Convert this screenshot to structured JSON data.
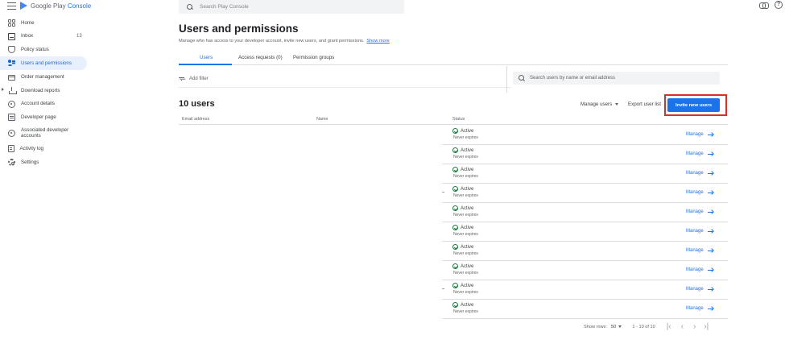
{
  "app": {
    "brand_prefix": "Google Play ",
    "brand_suffix": "Console",
    "top_search_placeholder": "Search Play Console"
  },
  "sidebar": {
    "items": [
      {
        "label": "Home",
        "icon": "home-grid-icon"
      },
      {
        "label": "Inbox",
        "icon": "inbox-icon",
        "badge": "13"
      },
      {
        "label": "Policy status",
        "icon": "shield-icon"
      },
      {
        "label": "Users and permissions",
        "icon": "users-icon",
        "selected": true
      },
      {
        "label": "Order management",
        "icon": "credit-card-icon"
      },
      {
        "label": "Download reports",
        "icon": "download-icon"
      },
      {
        "label": "Account details",
        "icon": "account-icon"
      },
      {
        "label": "Developer page",
        "icon": "developer-page-icon"
      },
      {
        "label": "Associated developer accounts",
        "icon": "associated-accounts-icon"
      },
      {
        "label": "Activity log",
        "icon": "activity-log-icon"
      },
      {
        "label": "Settings",
        "icon": "gear-icon"
      }
    ]
  },
  "page": {
    "title": "Users and permissions",
    "subtitle": "Manage who has access to your developer account, invite new users, and grant permissions.",
    "show_more": "Show more",
    "tabs": [
      {
        "label": "Users",
        "active": true
      },
      {
        "label": "Access requests (0)"
      },
      {
        "label": "Permission groups"
      }
    ],
    "add_filter": "Add filter",
    "user_search_placeholder": "Search users by name or email address",
    "count_title": "10 users",
    "manage_users": "Manage users",
    "export": "Export user list",
    "invite": "Invite new users",
    "highlight_color": "#d93025",
    "accent_color": "#1a73e8"
  },
  "table": {
    "columns": [
      "Email address",
      "Name",
      "Status"
    ],
    "rows": [
      {
        "status": "Active",
        "expires": "Never expires",
        "action": "Manage"
      },
      {
        "status": "Active",
        "expires": "Never expires",
        "action": "Manage"
      },
      {
        "status": "Active",
        "expires": "Never expires",
        "action": "Manage"
      },
      {
        "status": "Active",
        "expires": "Never expires",
        "action": "Manage"
      },
      {
        "status": "Active",
        "expires": "Never expires",
        "action": "Manage"
      },
      {
        "status": "Active",
        "expires": "Never expires",
        "action": "Manage"
      },
      {
        "status": "Active",
        "expires": "Never expires",
        "action": "Manage"
      },
      {
        "status": "Active",
        "expires": "Never expires",
        "action": "Manage"
      },
      {
        "status": "Active",
        "expires": "Never expires",
        "action": "Manage"
      },
      {
        "status": "Active",
        "expires": "Never expires",
        "action": "Manage"
      }
    ]
  },
  "pagination": {
    "rows_label": "Show rows:",
    "rows_value": "50",
    "range": "1 - 10 of 10",
    "first": "|‹",
    "prev": "‹",
    "next": "›",
    "last": "›|"
  }
}
